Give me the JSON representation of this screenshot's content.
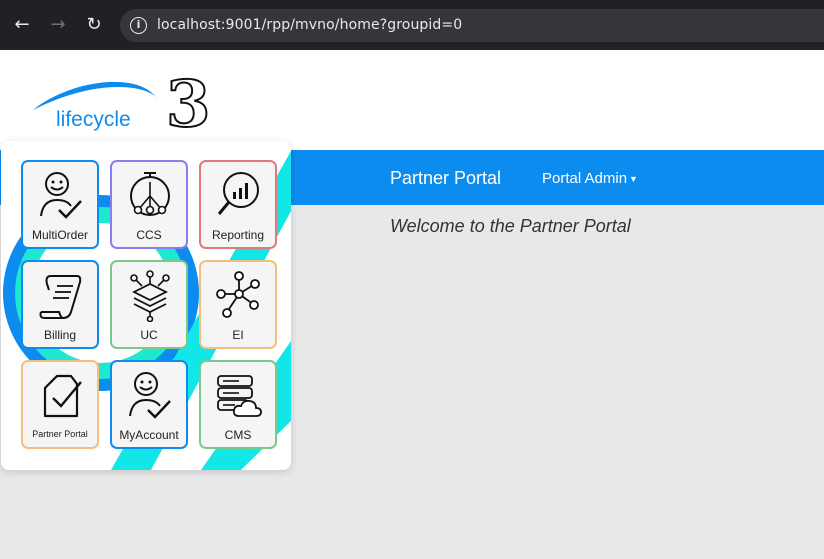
{
  "browser": {
    "url": "localhost:9001/rpp/mvno/home?groupid=0"
  },
  "header": {
    "logo_text": "lifecycle",
    "logo_mark": "3"
  },
  "navbar": {
    "brand": "Partner Portal",
    "menu_label": "Portal Admin"
  },
  "main": {
    "welcome": "Welcome to the Partner Portal"
  },
  "launcher": {
    "apps": [
      {
        "label": "MultiOrder",
        "icon": "person-check-icon",
        "border": "#0d8cf0"
      },
      {
        "label": "CCS",
        "icon": "stopwatch-network-icon",
        "border": "#8a7df0"
      },
      {
        "label": "Reporting",
        "icon": "magnifier-chart-icon",
        "border": "#e07a7a"
      },
      {
        "label": "Billing",
        "icon": "scroll-icon",
        "border": "#0d8cf0"
      },
      {
        "label": "UC",
        "icon": "layers-network-icon",
        "border": "#7bc98a"
      },
      {
        "label": "EI",
        "icon": "node-graph-icon",
        "border": "#f2c07a"
      },
      {
        "label": "Partner Portal",
        "icon": "document-check-icon",
        "border": "#f2c07a"
      },
      {
        "label": "MyAccount",
        "icon": "person-check-icon",
        "border": "#0d8cf0"
      },
      {
        "label": "CMS",
        "icon": "server-cloud-icon",
        "border": "#7bc98a"
      }
    ]
  }
}
